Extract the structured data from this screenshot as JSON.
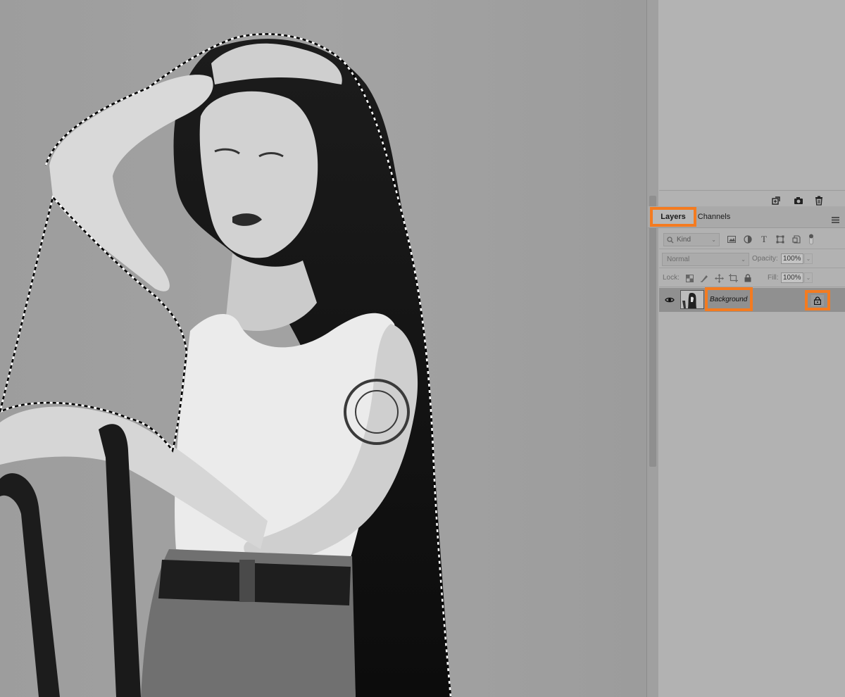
{
  "canvas": {
    "image_description": "black-and-white photo of a woman seated on a wooden chair, hand in her long hair, wearing a white tank top and tattoos, with a marching-ants selection outline around her"
  },
  "layers_panel": {
    "tabs": [
      {
        "label": "Layers",
        "active": true
      },
      {
        "label": "Channels",
        "active": false
      }
    ],
    "top_toolbar_icons": [
      "new-snapshot-icon",
      "camera-icon",
      "trash-icon"
    ],
    "filter": {
      "kind_label": "Kind",
      "icons": [
        "image-filter-icon",
        "adjustment-filter-icon",
        "type-filter-icon",
        "shape-filter-icon",
        "smart-object-filter-icon",
        "filter-toggle-icon"
      ]
    },
    "blend_mode": "Normal",
    "opacity_label": "Opacity:",
    "opacity_value": "100%",
    "lock_label": "Lock:",
    "lock_icons": [
      "lock-transparent-pixels-icon",
      "lock-image-pixels-icon",
      "lock-position-icon",
      "lock-artboard-icon",
      "lock-all-icon"
    ],
    "fill_label": "Fill:",
    "fill_value": "100%",
    "layers": [
      {
        "name": "Background",
        "visible": true,
        "locked": true
      }
    ],
    "highlight_color": "#f47b20"
  }
}
